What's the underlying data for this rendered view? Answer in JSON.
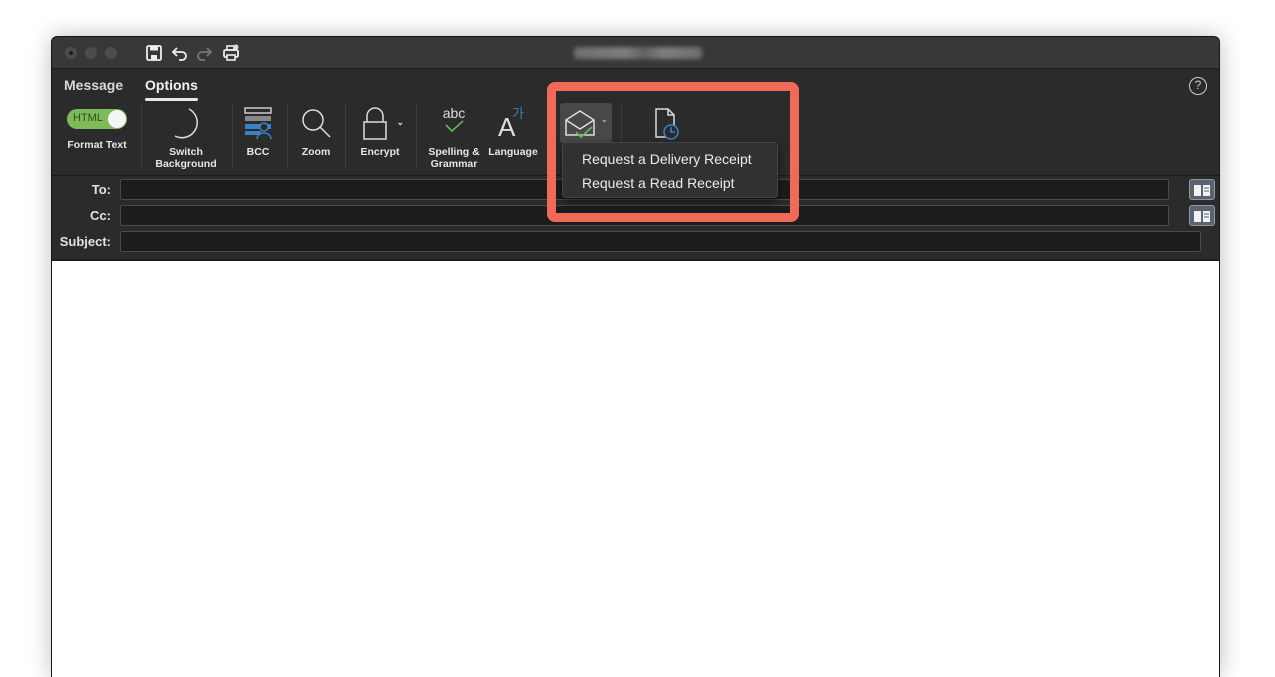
{
  "window": {
    "title_redacted": true,
    "quick_access": {
      "save": "save-icon",
      "undo": "undo-icon",
      "redo": "redo-icon",
      "print": "print-icon"
    }
  },
  "ribbon": {
    "tabs": [
      {
        "label": "Message",
        "active": false
      },
      {
        "label": "Options",
        "active": true
      }
    ],
    "help_label": "?",
    "buttons": {
      "format_text": {
        "toggle_label": "HTML",
        "label": "Format Text",
        "state": "on"
      },
      "switch_background": {
        "line1": "Switch",
        "line2": "Background"
      },
      "bcc": {
        "label": "BCC"
      },
      "zoom": {
        "label": "Zoom"
      },
      "encrypt": {
        "label": "Encrypt"
      },
      "spelling": {
        "icon_text": "abc",
        "line1": "Spelling &",
        "line2": "Grammar"
      },
      "language": {
        "label": "Language",
        "icon_text": "A",
        "icon_sup": "가"
      }
    }
  },
  "dropdown": {
    "items": [
      "Request a Delivery Receipt",
      "Request a Read Receipt"
    ]
  },
  "fields": {
    "to_label": "To:",
    "cc_label": "Cc:",
    "subject_label": "Subject:",
    "to_value": "",
    "cc_value": "",
    "subject_value": ""
  },
  "colors": {
    "highlight": "#f06a55",
    "toggle_on": "#7dbb5a",
    "accent_blue": "#3b82c4",
    "check_green": "#5fb760"
  }
}
